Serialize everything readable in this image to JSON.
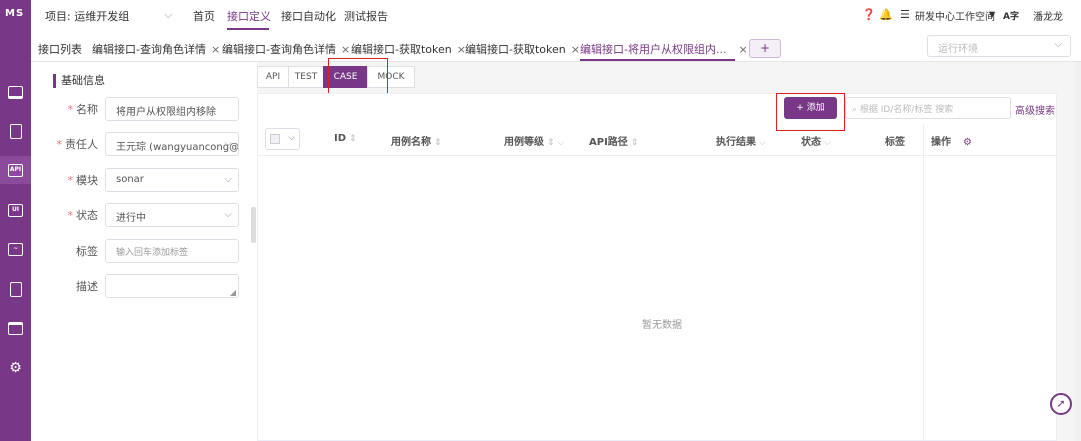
{
  "app": {
    "logo": "MS",
    "project": "项目: 运维开发组",
    "nav": [
      "首页",
      "接口定义",
      "接口自动化",
      "测试报告"
    ],
    "workspace": "研发中心工作空间",
    "language_badge": "A字",
    "user": "潘龙龙",
    "accent": "#783887"
  },
  "sidebar": {
    "icons": [
      "workstation-icon",
      "track-icon",
      "api-icon",
      "ui-icon",
      "performance-icon",
      "report-icon",
      "project-icon",
      "settings-icon"
    ],
    "active_index": 2
  },
  "tabs": {
    "list": "接口列表",
    "items": [
      {
        "label": "编辑接口-查询角色详情",
        "close": "×"
      },
      {
        "label": "编辑接口-查询角色详情",
        "close": "×"
      },
      {
        "label": "编辑接口-获取token",
        "close": "×"
      },
      {
        "label": "编辑接口-获取token",
        "close": "×"
      },
      {
        "label": "编辑接口-将用户从权限组内...",
        "close": "×"
      }
    ],
    "plus": "+",
    "env_placeholder": "运行环境"
  },
  "basic": {
    "title": "基础信息",
    "fields": [
      {
        "label": "名称",
        "required": true,
        "value": "将用户从权限组内移除"
      },
      {
        "label": "责任人",
        "required": true,
        "value": "王元琮 (wangyuancong@"
      },
      {
        "label": "模块",
        "required": true,
        "value": "sonar"
      },
      {
        "label": "状态",
        "required": true,
        "value": "进行中"
      },
      {
        "label": "标签",
        "required": false,
        "placeholder": "输入回车添加标签"
      },
      {
        "label": "描述",
        "required": false,
        "value": ""
      }
    ]
  },
  "mode_tabs": [
    "API",
    "TEST",
    "CASE",
    "MOCK"
  ],
  "mode_active": "CASE",
  "toolbar": {
    "add_label": "+ 添加",
    "search_placeholder": "根据 ID/名称/标签 搜索",
    "advanced": "高级搜索"
  },
  "table": {
    "headers": [
      "ID",
      "用例名称",
      "用例等级",
      "API路径",
      "执行结果",
      "状态",
      "标签",
      "操作"
    ],
    "empty": "暂无数据"
  }
}
